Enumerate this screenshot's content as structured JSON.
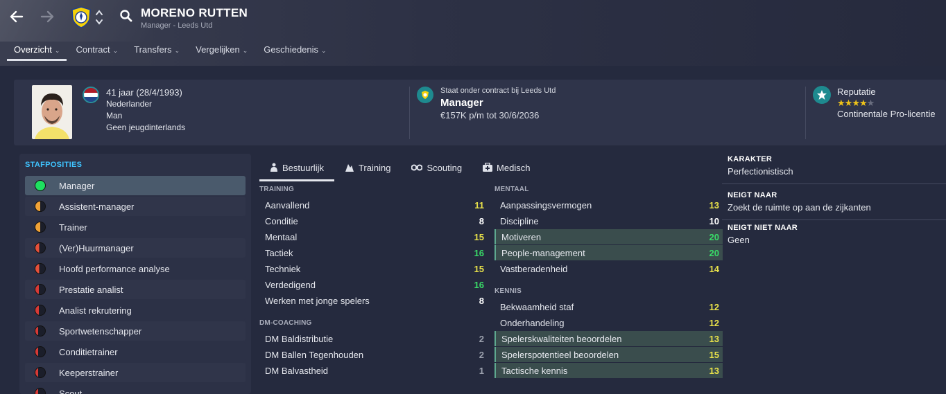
{
  "header": {
    "title": "MORENO RUTTEN",
    "subtitle": "Manager - Leeds Utd",
    "icons": [
      "arrow-left-icon",
      "arrow-right-icon",
      "club-crest-icon",
      "up-down-icon",
      "search-icon"
    ]
  },
  "nav_tabs": [
    {
      "label": "Overzicht",
      "active": true
    },
    {
      "label": "Contract"
    },
    {
      "label": "Transfers"
    },
    {
      "label": "Vergelijken"
    },
    {
      "label": "Geschiedenis"
    }
  ],
  "info": {
    "age_line": "41 jaar (28/4/1993)",
    "nationality": "Nederlander",
    "gender": "Man",
    "youth": "Geen jeugdinterlands",
    "contract_line": "Staat onder contract bij Leeds Utd",
    "role": "Manager",
    "wage": "€157K p/m tot 30/6/2036",
    "reputation_label": "Reputatie",
    "reputation_stars": 4,
    "reputation_max": 5,
    "license": "Continentale Pro-licentie"
  },
  "staff": {
    "header": "STAFPOSITIES",
    "items": [
      {
        "label": "Manager",
        "fill": 1.0
      },
      {
        "label": "Assistent-manager",
        "fill": 0.5
      },
      {
        "label": "Trainer",
        "fill": 0.5
      },
      {
        "label": "(Ver)Huurmanager",
        "fill": 0.4
      },
      {
        "label": "Hoofd performance analyse",
        "fill": 0.4
      },
      {
        "label": "Prestatie analist",
        "fill": 0.35
      },
      {
        "label": "Analist rekrutering",
        "fill": 0.35
      },
      {
        "label": "Sportwetenschapper",
        "fill": 0.3
      },
      {
        "label": "Conditietrainer",
        "fill": 0.3
      },
      {
        "label": "Keeperstrainer",
        "fill": 0.3
      },
      {
        "label": "Scout",
        "fill": 0.3
      }
    ]
  },
  "attr_tabs": [
    {
      "label": "Bestuurlijk",
      "icon": "person-icon",
      "active": true
    },
    {
      "label": "Training",
      "icon": "training-icon"
    },
    {
      "label": "Scouting",
      "icon": "binoculars-icon"
    },
    {
      "label": "Medisch",
      "icon": "medical-icon"
    }
  ],
  "training": {
    "header": "TRAINING",
    "rows": [
      {
        "name": "Aanvallend",
        "value": "11"
      },
      {
        "name": "Conditie",
        "value": "8"
      },
      {
        "name": "Mentaal",
        "value": "15"
      },
      {
        "name": "Tactiek",
        "value": "16"
      },
      {
        "name": "Techniek",
        "value": "15"
      },
      {
        "name": "Verdedigend",
        "value": "16"
      },
      {
        "name": "Werken met jonge spelers",
        "value": "8"
      }
    ]
  },
  "dm": {
    "header": "DM-COACHING",
    "rows": [
      {
        "name": "DM Baldistributie",
        "value": "2"
      },
      {
        "name": "DM Ballen Tegenhouden",
        "value": "2"
      },
      {
        "name": "DM Balvastheid",
        "value": "1"
      }
    ]
  },
  "mentaal": {
    "header": "MENTAAL",
    "rows": [
      {
        "name": "Aanpassingsvermogen",
        "value": "13"
      },
      {
        "name": "Discipline",
        "value": "10"
      },
      {
        "name": "Motiveren",
        "value": "20"
      },
      {
        "name": "People-management",
        "value": "20"
      },
      {
        "name": "Vastberadenheid",
        "value": "14"
      }
    ]
  },
  "kennis": {
    "header": "KENNIS",
    "rows": [
      {
        "name": "Bekwaamheid staf",
        "value": "12"
      },
      {
        "name": "Onderhandeling",
        "value": "12"
      },
      {
        "name": "Spelerskwaliteiten beoordelen",
        "value": "13"
      },
      {
        "name": "Spelerspotentieel beoordelen",
        "value": "15"
      },
      {
        "name": "Tactische kennis",
        "value": "13"
      }
    ]
  },
  "personality": {
    "karakter_h": "KARAKTER",
    "karakter": "Perfectionistisch",
    "neigt_h": "NEIGT NAAR",
    "neigt": "Zoekt de ruimte op aan de zijkanten",
    "neigt_niet_h": "NEIGT NIET NAAR",
    "neigt_niet": "Geen"
  },
  "colors": {
    "accent": "#3fc4ff",
    "teal": "#1e8a8f",
    "green_value": "#39dc68",
    "yellow_value": "#e8e14a",
    "highlight_row": "#3a4d4d"
  }
}
